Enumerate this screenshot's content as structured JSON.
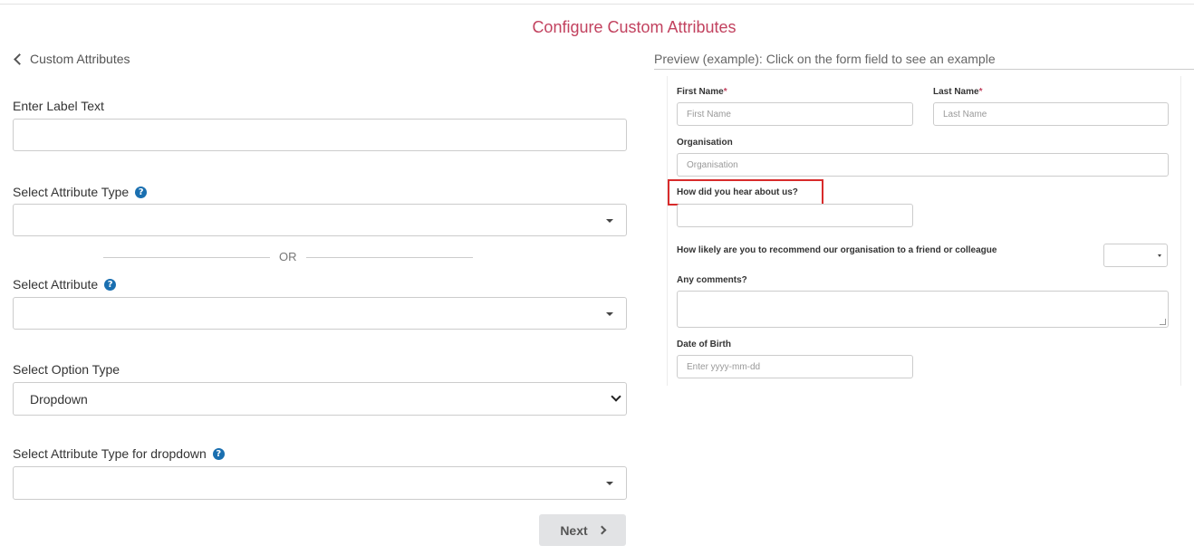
{
  "page": {
    "title": "Configure Custom Attributes"
  },
  "nav": {
    "back_label": "Custom Attributes"
  },
  "form": {
    "label_text": {
      "label": "Enter Label Text",
      "value": ""
    },
    "attribute_type": {
      "label": "Select Attribute Type",
      "value": ""
    },
    "or_label": "OR",
    "attribute": {
      "label": "Select Attribute",
      "value": ""
    },
    "option_type": {
      "label": "Select Option Type",
      "value": "Dropdown"
    },
    "dropdown_attribute_type": {
      "label": "Select Attribute Type for dropdown",
      "value": ""
    },
    "help_glyph": "?",
    "next_label": "Next"
  },
  "preview": {
    "label": "Preview (example): Click on the form field to see an example",
    "required_mark": "*",
    "first_name": {
      "label": "First Name",
      "placeholder": "First Name"
    },
    "last_name": {
      "label": "Last Name",
      "placeholder": "Last Name"
    },
    "organisation": {
      "label": "Organisation",
      "placeholder": "Organisation"
    },
    "hear_about": {
      "label": "How did you hear about us?",
      "placeholder": ""
    },
    "recommend": {
      "label": "How likely are you to recommend our organisation to a friend or colleague",
      "value": ""
    },
    "comments": {
      "label": "Any comments?"
    },
    "dob": {
      "label": "Date of Birth",
      "placeholder": "Enter yyyy-mm-dd"
    }
  },
  "colors": {
    "title": "#c2425f",
    "help_icon": "#1a6fb0",
    "highlight": "#d82b2b",
    "required": "#c2425f"
  },
  "icons": {
    "back": "chevron-left-icon",
    "help": "question-circle-icon",
    "next": "chevron-right-icon"
  }
}
